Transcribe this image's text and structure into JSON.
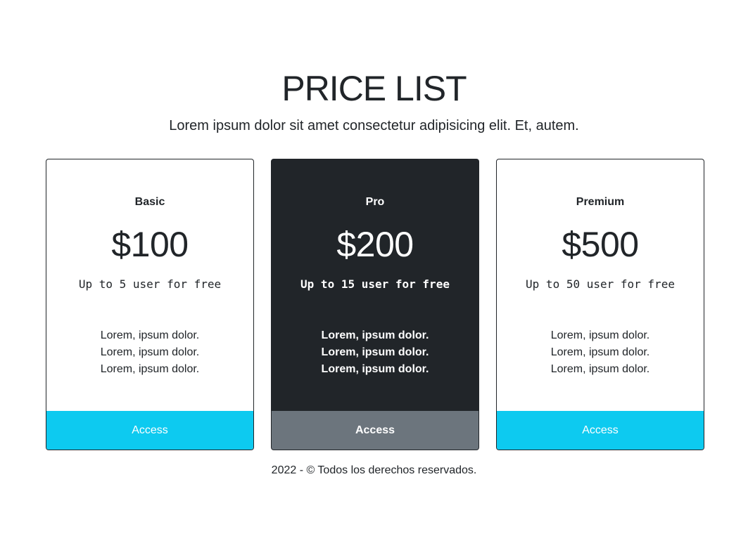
{
  "header": {
    "title": "PRICE LIST",
    "subtitle": "Lorem ipsum dolor sit amet consectetur adipisicing elit. Et, autem."
  },
  "plans": [
    {
      "name": "Basic",
      "price": "$100",
      "users": "Up to 5 user for free",
      "features": [
        "Lorem, ipsum dolor.",
        "Lorem, ipsum dolor.",
        "Lorem, ipsum dolor."
      ],
      "button_label": "Access",
      "theme": "light"
    },
    {
      "name": "Pro",
      "price": "$200",
      "users": "Up to 15 user for free",
      "features": [
        "Lorem, ipsum dolor.",
        "Lorem, ipsum dolor.",
        "Lorem, ipsum dolor."
      ],
      "button_label": "Access",
      "theme": "dark"
    },
    {
      "name": "Premium",
      "price": "$500",
      "users": "Up to 50 user for free",
      "features": [
        "Lorem, ipsum dolor.",
        "Lorem, ipsum dolor.",
        "Lorem, ipsum dolor."
      ],
      "button_label": "Access",
      "theme": "light"
    }
  ],
  "footer": {
    "text": "2022 - © Todos los derechos reservados."
  },
  "colors": {
    "text": "#212529",
    "dark_card": "#212529",
    "info_button": "#0dcaf0",
    "secondary_button": "#6c757d"
  }
}
